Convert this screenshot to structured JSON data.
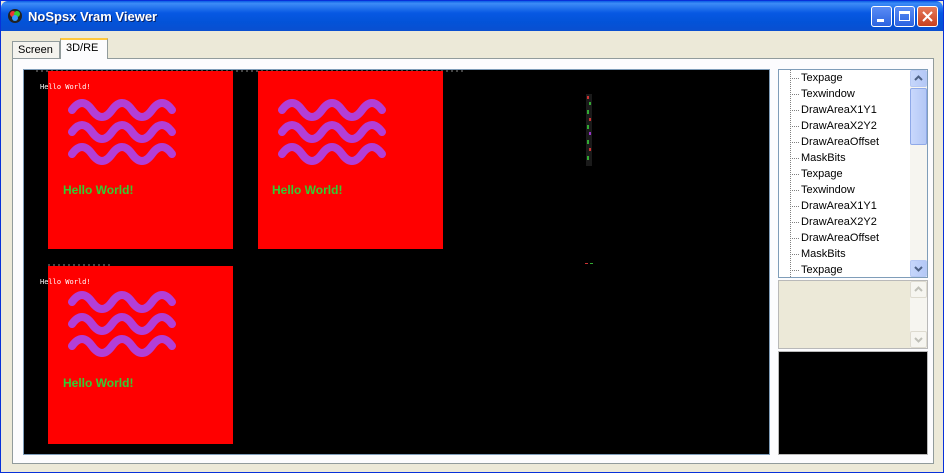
{
  "window": {
    "title": "NoSpsx Vram Viewer"
  },
  "tabs": [
    {
      "label": "Screen"
    },
    {
      "label": "3D/RE"
    }
  ],
  "vram": {
    "frame_texts": [
      "Hello World!",
      "Hello World!",
      "Hello World!"
    ],
    "small_texts": [
      "Hello World!",
      "Hello World!"
    ],
    "colors": {
      "background": "#000000",
      "frame": "#ff0000",
      "wave": "#b23fd6",
      "text": "#33cc33"
    }
  },
  "tree": {
    "items": [
      "Texpage",
      "Texwindow",
      "DrawAreaX1Y1",
      "DrawAreaX2Y2",
      "DrawAreaOffset",
      "MaskBits",
      "Texpage",
      "Texwindow",
      "DrawAreaX1Y1",
      "DrawAreaX2Y2",
      "DrawAreaOffset",
      "MaskBits",
      "Texpage"
    ]
  }
}
